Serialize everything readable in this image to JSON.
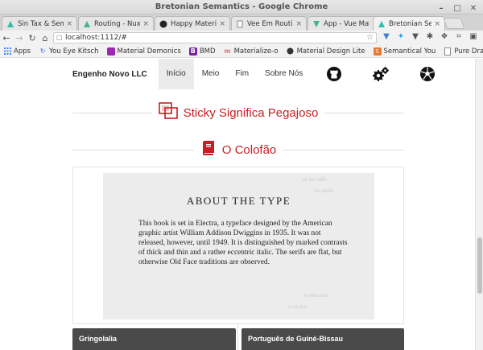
{
  "window": {
    "title": "Bretonian Semantics - Google Chrome"
  },
  "tabs": [
    {
      "label": "Sin Tax & Semanti",
      "icon": "semantic-icon",
      "active": false
    },
    {
      "label": "Routing - Nuxt.js",
      "icon": "nuxt-icon",
      "active": false
    },
    {
      "label": "Happy Material Th",
      "icon": "github-icon",
      "active": false
    },
    {
      "label": "Vee Em Routing",
      "icon": "page-icon",
      "active": false
    },
    {
      "label": "App - Vue Materia",
      "icon": "vue-icon",
      "active": false
    },
    {
      "label": "Bretonian Seman",
      "icon": "semantic-icon",
      "active": true
    }
  ],
  "address": {
    "url": "localhost:1112/#"
  },
  "bookmarks": [
    {
      "label": "Apps",
      "icon": "apps-grid-icon",
      "color": "#4285f4"
    },
    {
      "label": "You Eye Kitsch",
      "icon": "refresh-icon",
      "color": "#2a6ee0"
    },
    {
      "label": "Material Demonics",
      "icon": "material-icon",
      "color": "#9c27b0"
    },
    {
      "label": "BMD",
      "icon": "bmd-icon",
      "color": "#7b1fa2"
    },
    {
      "label": "Materialize-o",
      "icon": "materialize-icon",
      "color": "#ee6e73"
    },
    {
      "label": "Material Design Lite",
      "icon": "mdl-icon",
      "color": "#333333"
    },
    {
      "label": "Semantical You",
      "icon": "semantic-ui-icon",
      "color": "#e6772e"
    },
    {
      "label": "Pure Drawer",
      "icon": "page-icon",
      "color": "#777777"
    }
  ],
  "nav": {
    "brand": "Engenho Novo LLC",
    "links": [
      {
        "label": "Início",
        "active": true
      },
      {
        "label": "Meio",
        "active": false
      },
      {
        "label": "Fim",
        "active": false
      },
      {
        "label": "Sobre Nós",
        "active": false
      }
    ],
    "icons": [
      "github-icon",
      "cogs-icon",
      "soccer-ball-icon"
    ]
  },
  "sections": {
    "sticky": {
      "title": "Sticky Significa Pegajoso",
      "icon": "clone-icon"
    },
    "colofao": {
      "title": "O Colofão",
      "icon": "book-icon"
    }
  },
  "colophon": {
    "heading": "ABOUT THE TYPE",
    "body": "This book is set in Electra, a typeface designed by the American graphic artist William Addison Dwiggins in 1935. It was not released, however, until 1949. It is distinguished by marked contrasts of thick and thin and a rather eccentric italic. The serifs are flat, but otherwise Old Face traditions are observed."
  },
  "subcards": [
    {
      "title": "Gringolalia"
    },
    {
      "title": "Português de Guiné-Bissau"
    }
  ],
  "colors": {
    "accent": "#c81e22",
    "subcard_bg": "#4a4a4a"
  }
}
